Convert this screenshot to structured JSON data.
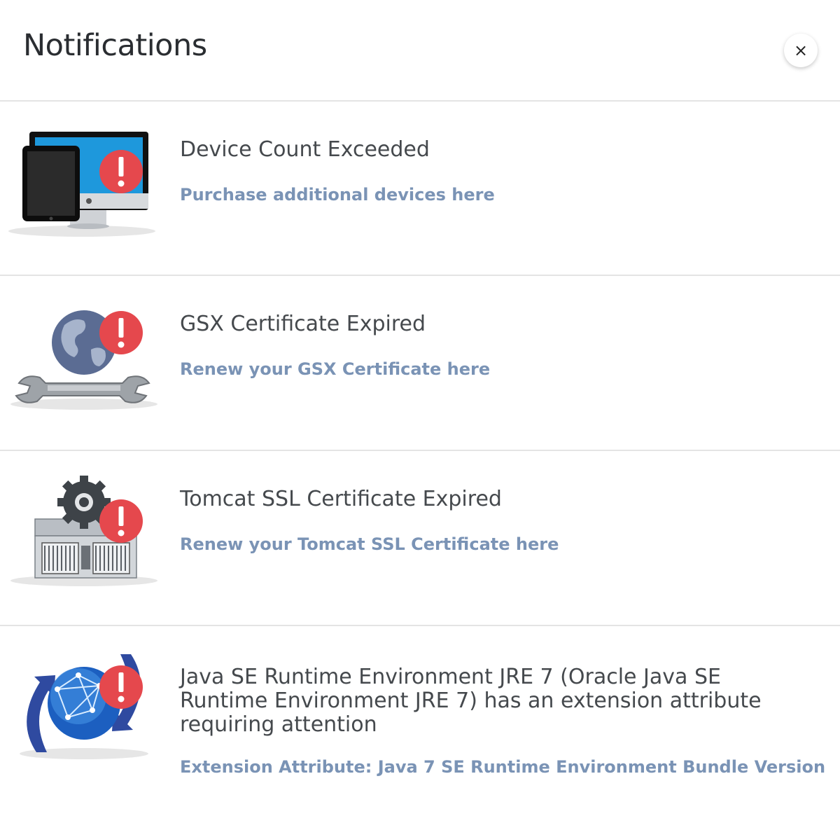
{
  "header": {
    "title": "Notifications",
    "close_label": "×"
  },
  "colors": {
    "alert_red": "#e5484d",
    "link_blue": "#7a93b5"
  },
  "notifications": [
    {
      "icon": "devices-icon",
      "title": "Device Count Exceeded",
      "link": "Purchase additional devices here"
    },
    {
      "icon": "globe-wrench-icon",
      "title": "GSX Certificate Expired",
      "link": "Renew your GSX Certificate here"
    },
    {
      "icon": "server-gear-icon",
      "title": "Tomcat SSL Certificate Expired",
      "link": "Renew your Tomcat SSL Certificate here"
    },
    {
      "icon": "network-globe-icon",
      "title": "Java SE Runtime Environment JRE 7 (Oracle Java SE Runtime Environment JRE 7) has an extension attribute requiring attention",
      "link": "Extension Attribute: Java 7 SE Runtime Environment Bundle Version"
    }
  ]
}
